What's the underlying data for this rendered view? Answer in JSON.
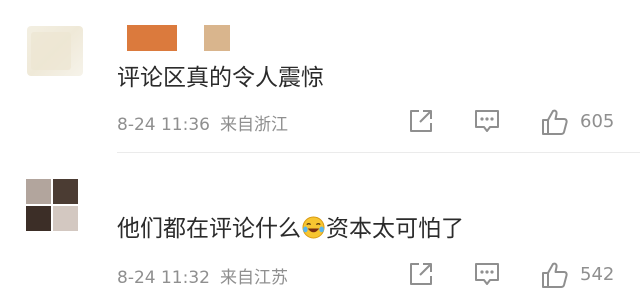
{
  "comments": [
    {
      "text": "评论区真的令人震惊",
      "time": "8-24 11:36",
      "location": "来自浙江",
      "likes": "605"
    },
    {
      "text_before": "他们都在评论什么",
      "emoji": "laugh-cry-emoji",
      "text_after": "资本太可怕了",
      "time": "8-24 11:32",
      "location": "来自江苏",
      "likes": "542"
    }
  ],
  "colors": {
    "text": "#2b2b2b",
    "meta": "#8f8f8f",
    "name_block_1": "#db7a3d",
    "name_block_2": "#d9b58d"
  }
}
